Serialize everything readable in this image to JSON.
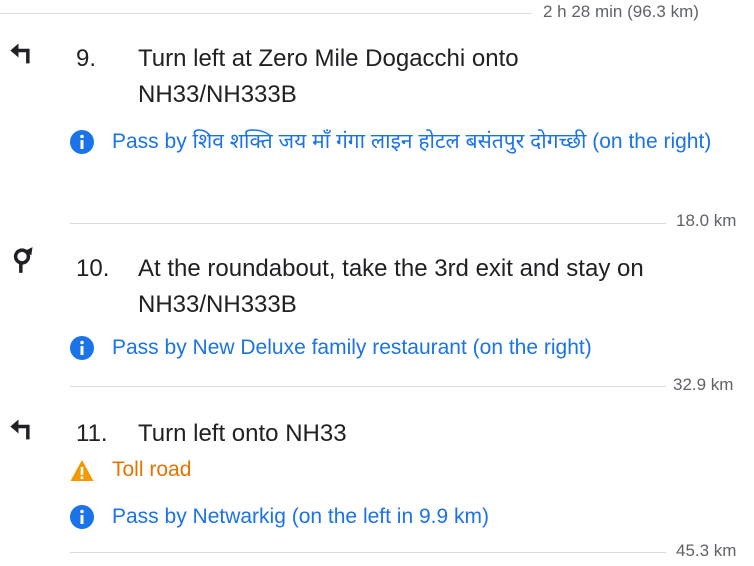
{
  "header": {
    "total_time": "2 h 28 min (96.3 km)"
  },
  "steps": [
    {
      "number": "9.",
      "instruction": "Turn left at Zero Mile Dogacchi onto NH33/NH333B",
      "notes": [
        {
          "type": "info",
          "text": "Pass by शिव शक्ति जय माँ गंगा लाइन होटल बसंतपुर दोगच्छी (on the right)"
        }
      ],
      "distance": "18.0 km",
      "icon": "turn-left-icon"
    },
    {
      "number": "10.",
      "instruction": "At the roundabout, take the 3rd exit and stay on NH33/NH333B",
      "notes": [
        {
          "type": "info",
          "text": "Pass by New Deluxe family restaurant (on the right)"
        }
      ],
      "distance": "32.9 km",
      "icon": "roundabout-icon"
    },
    {
      "number": "11.",
      "instruction": "Turn left onto NH33",
      "notes": [
        {
          "type": "warning",
          "text": "Toll road"
        },
        {
          "type": "info",
          "text": "Pass by Netwarkig (on the left in 9.9 km)"
        }
      ],
      "distance": "45.3 km",
      "icon": "turn-left-icon"
    }
  ],
  "colors": {
    "info": "#1a73e8",
    "warning": "#f29900",
    "text": "#202124",
    "muted": "#5f6368"
  }
}
